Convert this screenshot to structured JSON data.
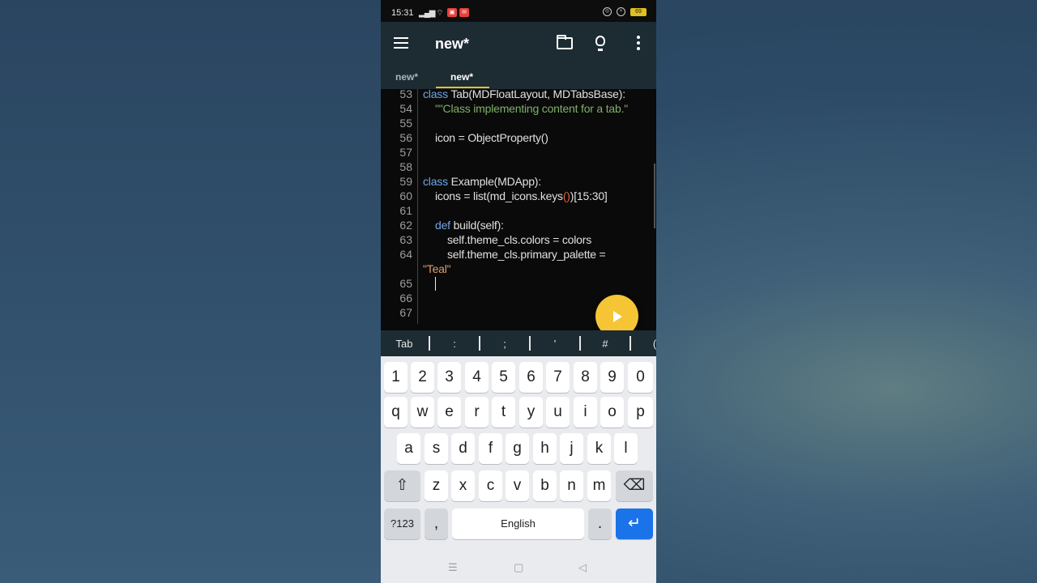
{
  "status_bar": {
    "time": "15:31",
    "battery": "69"
  },
  "app_bar": {
    "title": "new*"
  },
  "tabs": [
    {
      "label": "new*"
    },
    {
      "label": "new*"
    }
  ],
  "editor": {
    "lines": [
      {
        "num": "53",
        "top": 0
      },
      {
        "num": "54"
      },
      {
        "num": "55"
      },
      {
        "num": "56"
      },
      {
        "num": "57"
      },
      {
        "num": "58"
      },
      {
        "num": "59"
      },
      {
        "num": "60"
      },
      {
        "num": "61"
      },
      {
        "num": "62"
      },
      {
        "num": "63"
      },
      {
        "num": "64"
      },
      {
        "num": "65"
      },
      {
        "num": "66"
      },
      {
        "num": "67"
      }
    ],
    "code": {
      "l53_kw": "class",
      "l53_rest": " Tab(MDFloatLayout, MDTabsBase):",
      "l54": "\"\"Class implementing content for a tab.\"",
      "l56": "icon = ObjectProperty()",
      "l59_kw": "class",
      "l59_rest": " Example(MDApp):",
      "l60_a": "icons = list(md_icons.keys",
      "l60_paren": "()",
      "l60_b": ")[15:30]",
      "l62_kw": "def",
      "l62_rest": " build(self):",
      "l63": "self.theme_cls.colors = colors",
      "l64": "self.theme_cls.primary_palette =",
      "l64b": "\"Teal\""
    }
  },
  "symbol_bar": [
    "Tab",
    ":",
    ";",
    "'",
    "#",
    "("
  ],
  "keyboard": {
    "row_numbers": [
      "1",
      "2",
      "3",
      "4",
      "5",
      "6",
      "7",
      "8",
      "9",
      "0"
    ],
    "row1": [
      "q",
      "w",
      "e",
      "r",
      "t",
      "y",
      "u",
      "i",
      "o",
      "p"
    ],
    "row2": [
      "a",
      "s",
      "d",
      "f",
      "g",
      "h",
      "j",
      "k",
      "l"
    ],
    "row3": [
      "z",
      "x",
      "c",
      "v",
      "b",
      "n",
      "m"
    ],
    "sym_key": "?123",
    "comma": ",",
    "space": "English",
    "period": "."
  },
  "icons": [
    "menu-icon",
    "folder-icon",
    "lightbulb-icon",
    "more-vert-icon",
    "play-icon",
    "shift-icon",
    "backspace-icon",
    "enter-icon"
  ]
}
